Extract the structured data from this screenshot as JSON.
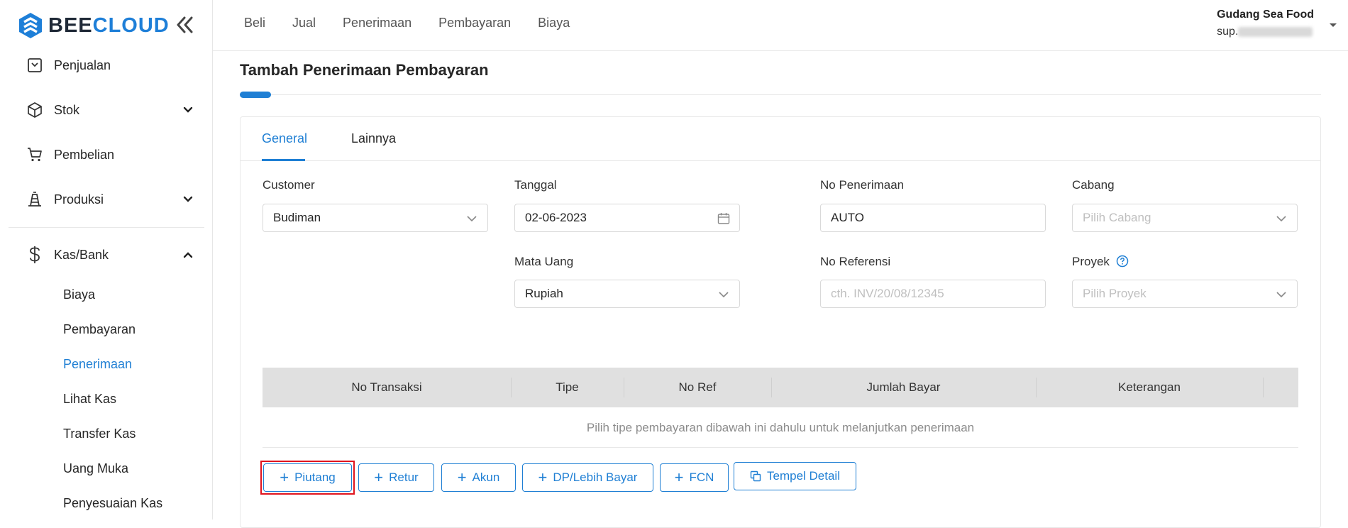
{
  "brand": {
    "part1": "BEE",
    "part2": "CLOUD"
  },
  "sidebar": {
    "items": [
      {
        "label": "Penjualan"
      },
      {
        "label": "Stok"
      },
      {
        "label": "Pembelian"
      },
      {
        "label": "Produksi"
      },
      {
        "label": "Kas/Bank"
      }
    ],
    "sub_items": [
      {
        "label": "Biaya"
      },
      {
        "label": "Pembayaran"
      },
      {
        "label": "Penerimaan"
      },
      {
        "label": "Lihat Kas"
      },
      {
        "label": "Transfer Kas"
      },
      {
        "label": "Uang Muka"
      },
      {
        "label": "Penyesuaian Kas"
      }
    ],
    "active_sub": "Penerimaan"
  },
  "topnav": [
    "Beli",
    "Jual",
    "Penerimaan",
    "Pembayaran",
    "Biaya"
  ],
  "user": {
    "name": "Gudang Sea Food",
    "email_prefix": "sup."
  },
  "page": {
    "title": "Tambah Penerimaan Pembayaran"
  },
  "tabs": [
    {
      "label": "General"
    },
    {
      "label": "Lainnya"
    }
  ],
  "form": {
    "customer": {
      "label": "Customer",
      "value": "Budiman"
    },
    "tanggal": {
      "label": "Tanggal",
      "value": "02-06-2023"
    },
    "no_penerimaan": {
      "label": "No Penerimaan",
      "value": "AUTO"
    },
    "cabang": {
      "label": "Cabang",
      "placeholder": "Pilih Cabang"
    },
    "mata_uang": {
      "label": "Mata Uang",
      "value": "Rupiah"
    },
    "no_referensi": {
      "label": "No Referensi",
      "placeholder": "cth. INV/20/08/12345"
    },
    "proyek": {
      "label": "Proyek",
      "placeholder": "Pilih Proyek"
    }
  },
  "table": {
    "columns": [
      "No Transaksi",
      "Tipe",
      "No Ref",
      "Jumlah Bayar",
      "Keterangan"
    ],
    "empty_text": "Pilih tipe pembayaran dibawah ini dahulu untuk melanjutkan penerimaan"
  },
  "buttons": {
    "piutang": "Piutang",
    "retur": "Retur",
    "akun": "Akun",
    "dp": "DP/Lebih Bayar",
    "fcn": "FCN",
    "tempel": "Tempel Detail"
  },
  "colors": {
    "primary": "#1f7fd4",
    "highlight": "#e0141e"
  }
}
